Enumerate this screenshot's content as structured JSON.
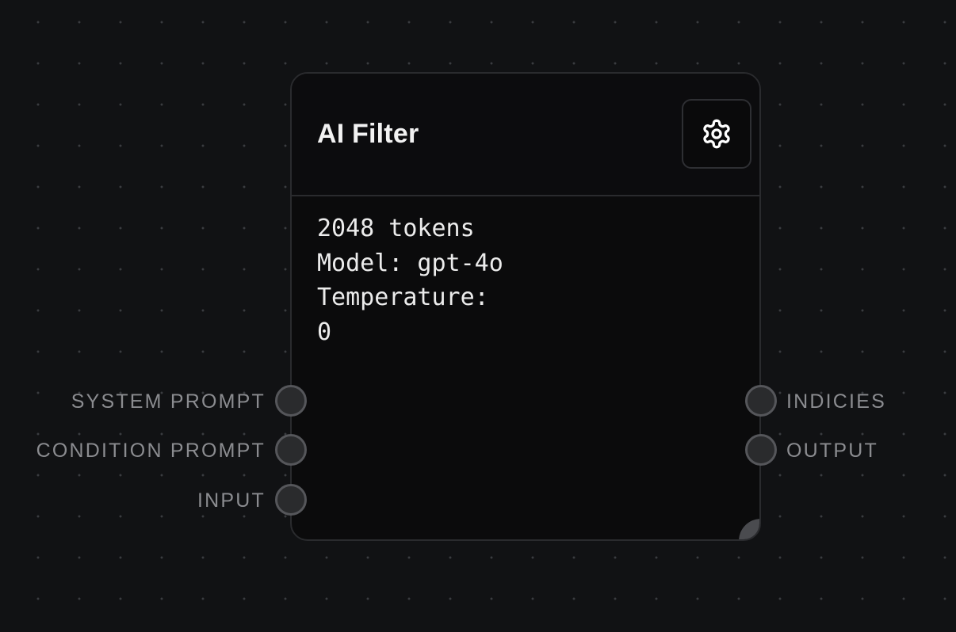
{
  "node": {
    "title": "AI Filter",
    "settings_icon": "gear-icon",
    "info": {
      "tokens": "2048 tokens",
      "model": "Model: gpt-4o",
      "temperature_label": "Temperature:",
      "temperature_value": "0"
    },
    "inputs": [
      {
        "label": "SYSTEM PROMPT"
      },
      {
        "label": "CONDITION PROMPT"
      },
      {
        "label": "INPUT"
      }
    ],
    "outputs": [
      {
        "label": "INDICIES"
      },
      {
        "label": "OUTPUT"
      }
    ]
  },
  "colors": {
    "background": "#111214",
    "node_background": "#0b0b0c",
    "node_border": "#2a2b2e",
    "port_fill": "#2a2b2d",
    "port_border": "#55565a",
    "label_text": "#8b8c90",
    "title_text": "#f2f2f2"
  }
}
